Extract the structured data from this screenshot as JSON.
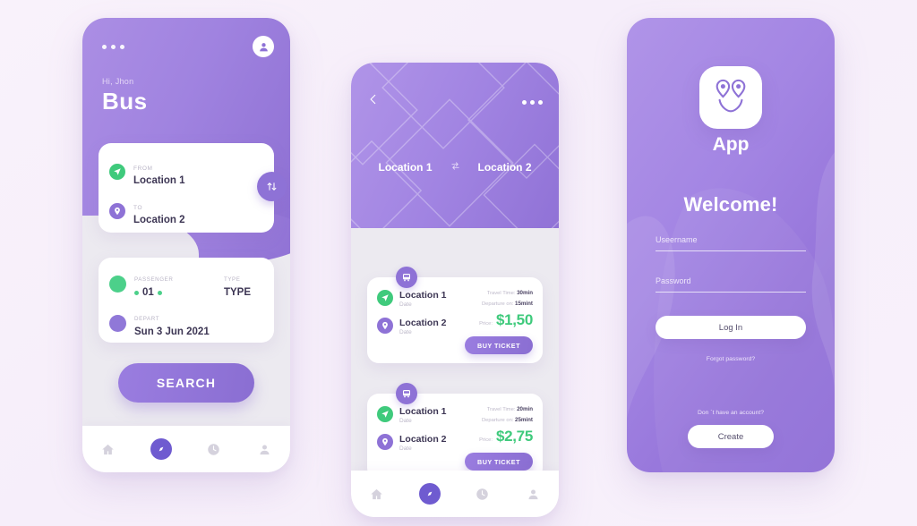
{
  "theme": {
    "page_bg": "#f8f1fb",
    "purple_light": "#b094e8",
    "purple_dark": "#8e6dd6",
    "accent_green": "#3fca7c",
    "nav_active": "#6f5bd0",
    "text_dark": "#3d3654",
    "text_muted": "#bdb8c9"
  },
  "screen1": {
    "greeting": "Hi, Jhon",
    "title": "Bus",
    "menu_icon": "more-dots-icon",
    "avatar_icon": "user-avatar-icon",
    "route": {
      "from_label": "FROM",
      "from_value": "Location 1",
      "to_label": "TO",
      "to_value": "Location 2",
      "swap_icon": "swap-vertical-icon"
    },
    "detail": {
      "passenger_label": "PASSENGER",
      "passenger_value": "01",
      "type_label": "TYPE",
      "type_value": "TYPE",
      "depart_label": "DEPART",
      "depart_value": "Sun 3 Jun 2021"
    },
    "search_label": "SEARCH",
    "nav": [
      {
        "icon": "home-icon",
        "active": false
      },
      {
        "icon": "compass-icon",
        "active": true
      },
      {
        "icon": "clock-icon",
        "active": false
      },
      {
        "icon": "person-icon",
        "active": false
      }
    ]
  },
  "screen2": {
    "back_icon": "chevron-left-icon",
    "menu_icon": "more-dots-icon",
    "from_location": "Location 1",
    "to_location": "Location 2",
    "swap_icon": "swap-horizontal-icon",
    "tickets": [
      {
        "badge_icon": "bus-icon",
        "from": "Location 1",
        "from_sub": "Date",
        "to": "Location 2",
        "to_sub": "Date",
        "travel_time_label": "Travel Time:",
        "travel_time_value": "30min",
        "departure_label": "Departure on:",
        "departure_value": "15mint",
        "price_label": "Price:",
        "price_value": "$1,50",
        "buy_label": "BUY TICKET"
      },
      {
        "badge_icon": "bus-icon",
        "from": "Location 1",
        "from_sub": "Date",
        "to": "Location 2",
        "to_sub": "Date",
        "travel_time_label": "Travel Time:",
        "travel_time_value": "20min",
        "departure_label": "Departure on:",
        "departure_value": "25mint",
        "price_label": "Price:",
        "price_value": "$2,75",
        "buy_label": "BUY TICKET"
      }
    ],
    "nav": [
      {
        "icon": "home-icon",
        "active": false
      },
      {
        "icon": "compass-icon",
        "active": true
      },
      {
        "icon": "clock-icon",
        "active": false
      },
      {
        "icon": "person-icon",
        "active": false
      }
    ]
  },
  "screen3": {
    "logo_icon": "smiley-map-pins-logo",
    "app_name": "App",
    "welcome": "Welcome!",
    "username_placeholder": "Useername",
    "password_placeholder": "Password",
    "login_label": "Log In",
    "forgot_label": "Forgot password?",
    "no_account_label": "Don ´t have an account?",
    "create_label": "Create"
  }
}
